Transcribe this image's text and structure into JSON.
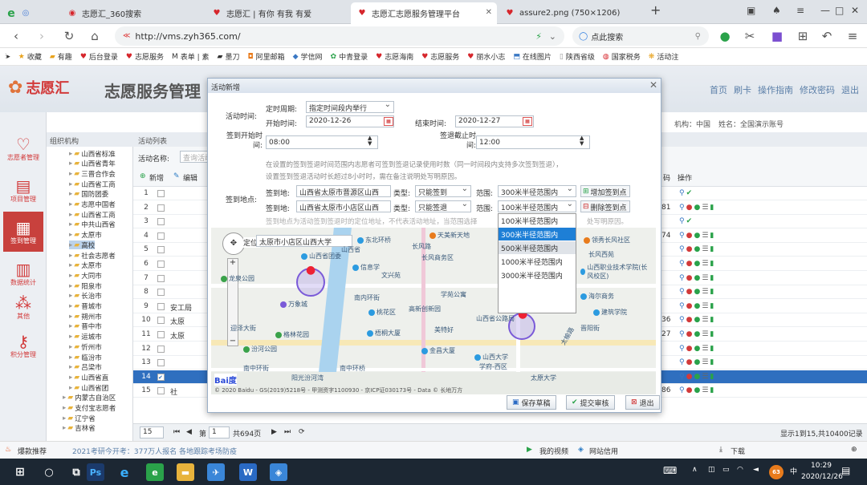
{
  "browser": {
    "tabs": [
      {
        "title": "志愿汇_360搜索",
        "icon": "e-icon"
      },
      {
        "title": "志愿汇 | 有你 有我 有爱",
        "icon": "heart-icon"
      },
      {
        "title": "志愿汇志愿服务管理平台",
        "icon": "heart-icon"
      },
      {
        "title": "assure2.png (750×1206)",
        "icon": "heart-icon"
      }
    ],
    "url": "http://vms.zyh365.com/",
    "search_placeholder": "点此搜索",
    "bookmarks": [
      "收藏",
      "有趣",
      "后台登录",
      "志愿服务",
      "表单 | 素",
      "墨刀",
      "阿里邮箱",
      "学信网",
      "中青登录",
      "志愿海南",
      "志愿服务",
      "丽水小志",
      "在线图片",
      "陕西省级",
      "国家税务",
      "活动注"
    ]
  },
  "app": {
    "logo": "志愿汇",
    "title": "志愿服务管理",
    "top_links": [
      "首页",
      "刷卡",
      "操作指南",
      "修改密码",
      "退出"
    ],
    "org_label": "机构：中国",
    "user_label": "姓名：全国演示账号",
    "rail": [
      "志愿者管理",
      "项目管理",
      "签到管理",
      "数据统计",
      "其他",
      "积分管理"
    ]
  },
  "tree": {
    "header": "组织机构",
    "items": [
      "山西省标准",
      "山西省青年",
      "三晋合作会",
      "山西省工商",
      "国防团委",
      "志愿中国者",
      "山西省工商",
      "中共山西省",
      "太原市",
      "高校",
      "社会志愿者",
      "太原市",
      "大同市",
      "阳泉市",
      "长治市",
      "晋城市",
      "朔州市",
      "晋中市",
      "运城市",
      "忻州市",
      "临汾市",
      "吕梁市",
      "山西省直",
      "山西省团",
      "内蒙古自治区",
      "支付宝志愿者",
      "辽宁省",
      "吉林省"
    ]
  },
  "grid": {
    "header": "活动列表",
    "search_label": "活动名称:",
    "search_placeholder": "查询活动",
    "add_label": "新增",
    "edit_label": "编辑",
    "col_code": "码",
    "col_ops": "操作",
    "rows": [
      "1",
      "2",
      "3",
      "4",
      "5",
      "6",
      "7",
      "8",
      "9",
      "10",
      "11",
      "12",
      "13",
      "14",
      "15"
    ],
    "row_nums": [
      "",
      "81",
      "",
      "74",
      "",
      "",
      "",
      "",
      "",
      "36",
      "27",
      "",
      "",
      "",
      "86"
    ],
    "side_text": [
      "",
      "",
      "",
      "",
      "",
      "",
      "",
      "",
      "安工局",
      "太原",
      "太原",
      "",
      "",
      "",
      "社"
    ],
    "pager": {
      "page_size": "15",
      "page_label": "第",
      "page_value": "1",
      "total_pages": "共694页",
      "summary": "显示1到15,共10400记录"
    }
  },
  "dialog": {
    "title": "活动新增",
    "cycle_label": "定时周期:",
    "cycle_value": "指定时间段内举行",
    "activity_time_label": "活动时间:",
    "start_label": "开始时间:",
    "start_value": "2020-12-26",
    "end_label": "结束时间:",
    "end_value": "2020-12-27",
    "checkin_start_label": "签到开始时间:",
    "checkin_start_value": "08:00",
    "checkin_end_label": "签退截止时间:",
    "checkin_end_value": "12:00",
    "note1": "在设置的签到签退时间范围内志愿者可签到签退记录使用时数（同一时间段内支持多次签到签退），",
    "note2": "设置签到签退活动时长超过8小时时，需在备注说明处写明原因。",
    "location_label": "签到地点:",
    "checkin_addr_label": "签到地:",
    "addr1": "山西省太原市晋源区山西",
    "addr2": "山西省太原市小店区山西",
    "type_label": "类型:",
    "type1": "只能签到",
    "type2": "只能签退",
    "range_label": "范围:",
    "range1": "300米半径范围内",
    "range2": "100米半径范围内",
    "add_point": "增加签到点",
    "delete_point": "删除签到点",
    "note3": "签到地点为活动签到签退时的定位地址，不代表活动地址，当范围选择",
    "note3b": "处写明原因。",
    "range_options": [
      "100米半径范围内",
      "300米半径范围内",
      "500米半径范围内",
      "1000米半径范围内",
      "3000米半径范围内"
    ],
    "map_search_label": "定位:",
    "map_search_value": "太原市小店区山西大学",
    "baidu": "Bai度",
    "copyright": "© 2020 Baidu - GS(2019)5218号 - 甲测资字1100930 - 京ICP证030173号 - Data © 长地万方",
    "save_draft": "保存草稿",
    "submit": "提交审核",
    "exit": "退出"
  },
  "map": {
    "pois": [
      "东北环桥",
      "长风路",
      "天美新天地",
      "山西省团委",
      "山西省",
      "长风商务区",
      "领秀长风社区",
      "龙泉公园",
      "信息学",
      "文兴苑",
      "山西职业技术学院(长风校区)",
      "长风西苑",
      "万象城",
      "学苑公寓",
      "海尔商务",
      "南中环街",
      "南中环桥",
      "山西省公路局",
      "山西大学",
      "学府-西区",
      "太原大学",
      "阳光汾河湾",
      "金昌大厦",
      "高新创新园",
      "南内环街",
      "汾河公园",
      "梧桐大厦",
      "桃花区",
      "美特好",
      "格林花园",
      "迎泽大街",
      "太榆路",
      "建筑学院",
      "晋阳街"
    ]
  },
  "status": {
    "left_news": "爆款推荐",
    "news": "2021考研今开考：377万人报名 各地跟踪考场防疫",
    "right": [
      "我的视频",
      "网站信用",
      "下载"
    ]
  },
  "taskbar": {
    "time": "10:29",
    "date": "2020/12/26"
  }
}
